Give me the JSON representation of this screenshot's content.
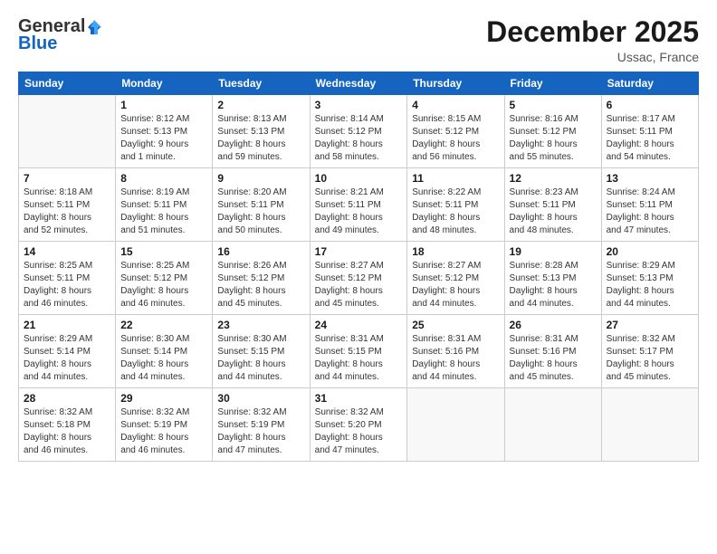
{
  "header": {
    "logo_general": "General",
    "logo_blue": "Blue",
    "month_title": "December 2025",
    "location": "Ussac, France"
  },
  "days_of_week": [
    "Sunday",
    "Monday",
    "Tuesday",
    "Wednesday",
    "Thursday",
    "Friday",
    "Saturday"
  ],
  "weeks": [
    [
      {
        "day": "",
        "info": ""
      },
      {
        "day": "1",
        "info": "Sunrise: 8:12 AM\nSunset: 5:13 PM\nDaylight: 9 hours\nand 1 minute."
      },
      {
        "day": "2",
        "info": "Sunrise: 8:13 AM\nSunset: 5:13 PM\nDaylight: 8 hours\nand 59 minutes."
      },
      {
        "day": "3",
        "info": "Sunrise: 8:14 AM\nSunset: 5:12 PM\nDaylight: 8 hours\nand 58 minutes."
      },
      {
        "day": "4",
        "info": "Sunrise: 8:15 AM\nSunset: 5:12 PM\nDaylight: 8 hours\nand 56 minutes."
      },
      {
        "day": "5",
        "info": "Sunrise: 8:16 AM\nSunset: 5:12 PM\nDaylight: 8 hours\nand 55 minutes."
      },
      {
        "day": "6",
        "info": "Sunrise: 8:17 AM\nSunset: 5:11 PM\nDaylight: 8 hours\nand 54 minutes."
      }
    ],
    [
      {
        "day": "7",
        "info": "Sunrise: 8:18 AM\nSunset: 5:11 PM\nDaylight: 8 hours\nand 52 minutes."
      },
      {
        "day": "8",
        "info": "Sunrise: 8:19 AM\nSunset: 5:11 PM\nDaylight: 8 hours\nand 51 minutes."
      },
      {
        "day": "9",
        "info": "Sunrise: 8:20 AM\nSunset: 5:11 PM\nDaylight: 8 hours\nand 50 minutes."
      },
      {
        "day": "10",
        "info": "Sunrise: 8:21 AM\nSunset: 5:11 PM\nDaylight: 8 hours\nand 49 minutes."
      },
      {
        "day": "11",
        "info": "Sunrise: 8:22 AM\nSunset: 5:11 PM\nDaylight: 8 hours\nand 48 minutes."
      },
      {
        "day": "12",
        "info": "Sunrise: 8:23 AM\nSunset: 5:11 PM\nDaylight: 8 hours\nand 48 minutes."
      },
      {
        "day": "13",
        "info": "Sunrise: 8:24 AM\nSunset: 5:11 PM\nDaylight: 8 hours\nand 47 minutes."
      }
    ],
    [
      {
        "day": "14",
        "info": "Sunrise: 8:25 AM\nSunset: 5:11 PM\nDaylight: 8 hours\nand 46 minutes."
      },
      {
        "day": "15",
        "info": "Sunrise: 8:25 AM\nSunset: 5:12 PM\nDaylight: 8 hours\nand 46 minutes."
      },
      {
        "day": "16",
        "info": "Sunrise: 8:26 AM\nSunset: 5:12 PM\nDaylight: 8 hours\nand 45 minutes."
      },
      {
        "day": "17",
        "info": "Sunrise: 8:27 AM\nSunset: 5:12 PM\nDaylight: 8 hours\nand 45 minutes."
      },
      {
        "day": "18",
        "info": "Sunrise: 8:27 AM\nSunset: 5:12 PM\nDaylight: 8 hours\nand 44 minutes."
      },
      {
        "day": "19",
        "info": "Sunrise: 8:28 AM\nSunset: 5:13 PM\nDaylight: 8 hours\nand 44 minutes."
      },
      {
        "day": "20",
        "info": "Sunrise: 8:29 AM\nSunset: 5:13 PM\nDaylight: 8 hours\nand 44 minutes."
      }
    ],
    [
      {
        "day": "21",
        "info": "Sunrise: 8:29 AM\nSunset: 5:14 PM\nDaylight: 8 hours\nand 44 minutes."
      },
      {
        "day": "22",
        "info": "Sunrise: 8:30 AM\nSunset: 5:14 PM\nDaylight: 8 hours\nand 44 minutes."
      },
      {
        "day": "23",
        "info": "Sunrise: 8:30 AM\nSunset: 5:15 PM\nDaylight: 8 hours\nand 44 minutes."
      },
      {
        "day": "24",
        "info": "Sunrise: 8:31 AM\nSunset: 5:15 PM\nDaylight: 8 hours\nand 44 minutes."
      },
      {
        "day": "25",
        "info": "Sunrise: 8:31 AM\nSunset: 5:16 PM\nDaylight: 8 hours\nand 44 minutes."
      },
      {
        "day": "26",
        "info": "Sunrise: 8:31 AM\nSunset: 5:16 PM\nDaylight: 8 hours\nand 45 minutes."
      },
      {
        "day": "27",
        "info": "Sunrise: 8:32 AM\nSunset: 5:17 PM\nDaylight: 8 hours\nand 45 minutes."
      }
    ],
    [
      {
        "day": "28",
        "info": "Sunrise: 8:32 AM\nSunset: 5:18 PM\nDaylight: 8 hours\nand 46 minutes."
      },
      {
        "day": "29",
        "info": "Sunrise: 8:32 AM\nSunset: 5:19 PM\nDaylight: 8 hours\nand 46 minutes."
      },
      {
        "day": "30",
        "info": "Sunrise: 8:32 AM\nSunset: 5:19 PM\nDaylight: 8 hours\nand 47 minutes."
      },
      {
        "day": "31",
        "info": "Sunrise: 8:32 AM\nSunset: 5:20 PM\nDaylight: 8 hours\nand 47 minutes."
      },
      {
        "day": "",
        "info": ""
      },
      {
        "day": "",
        "info": ""
      },
      {
        "day": "",
        "info": ""
      }
    ]
  ]
}
